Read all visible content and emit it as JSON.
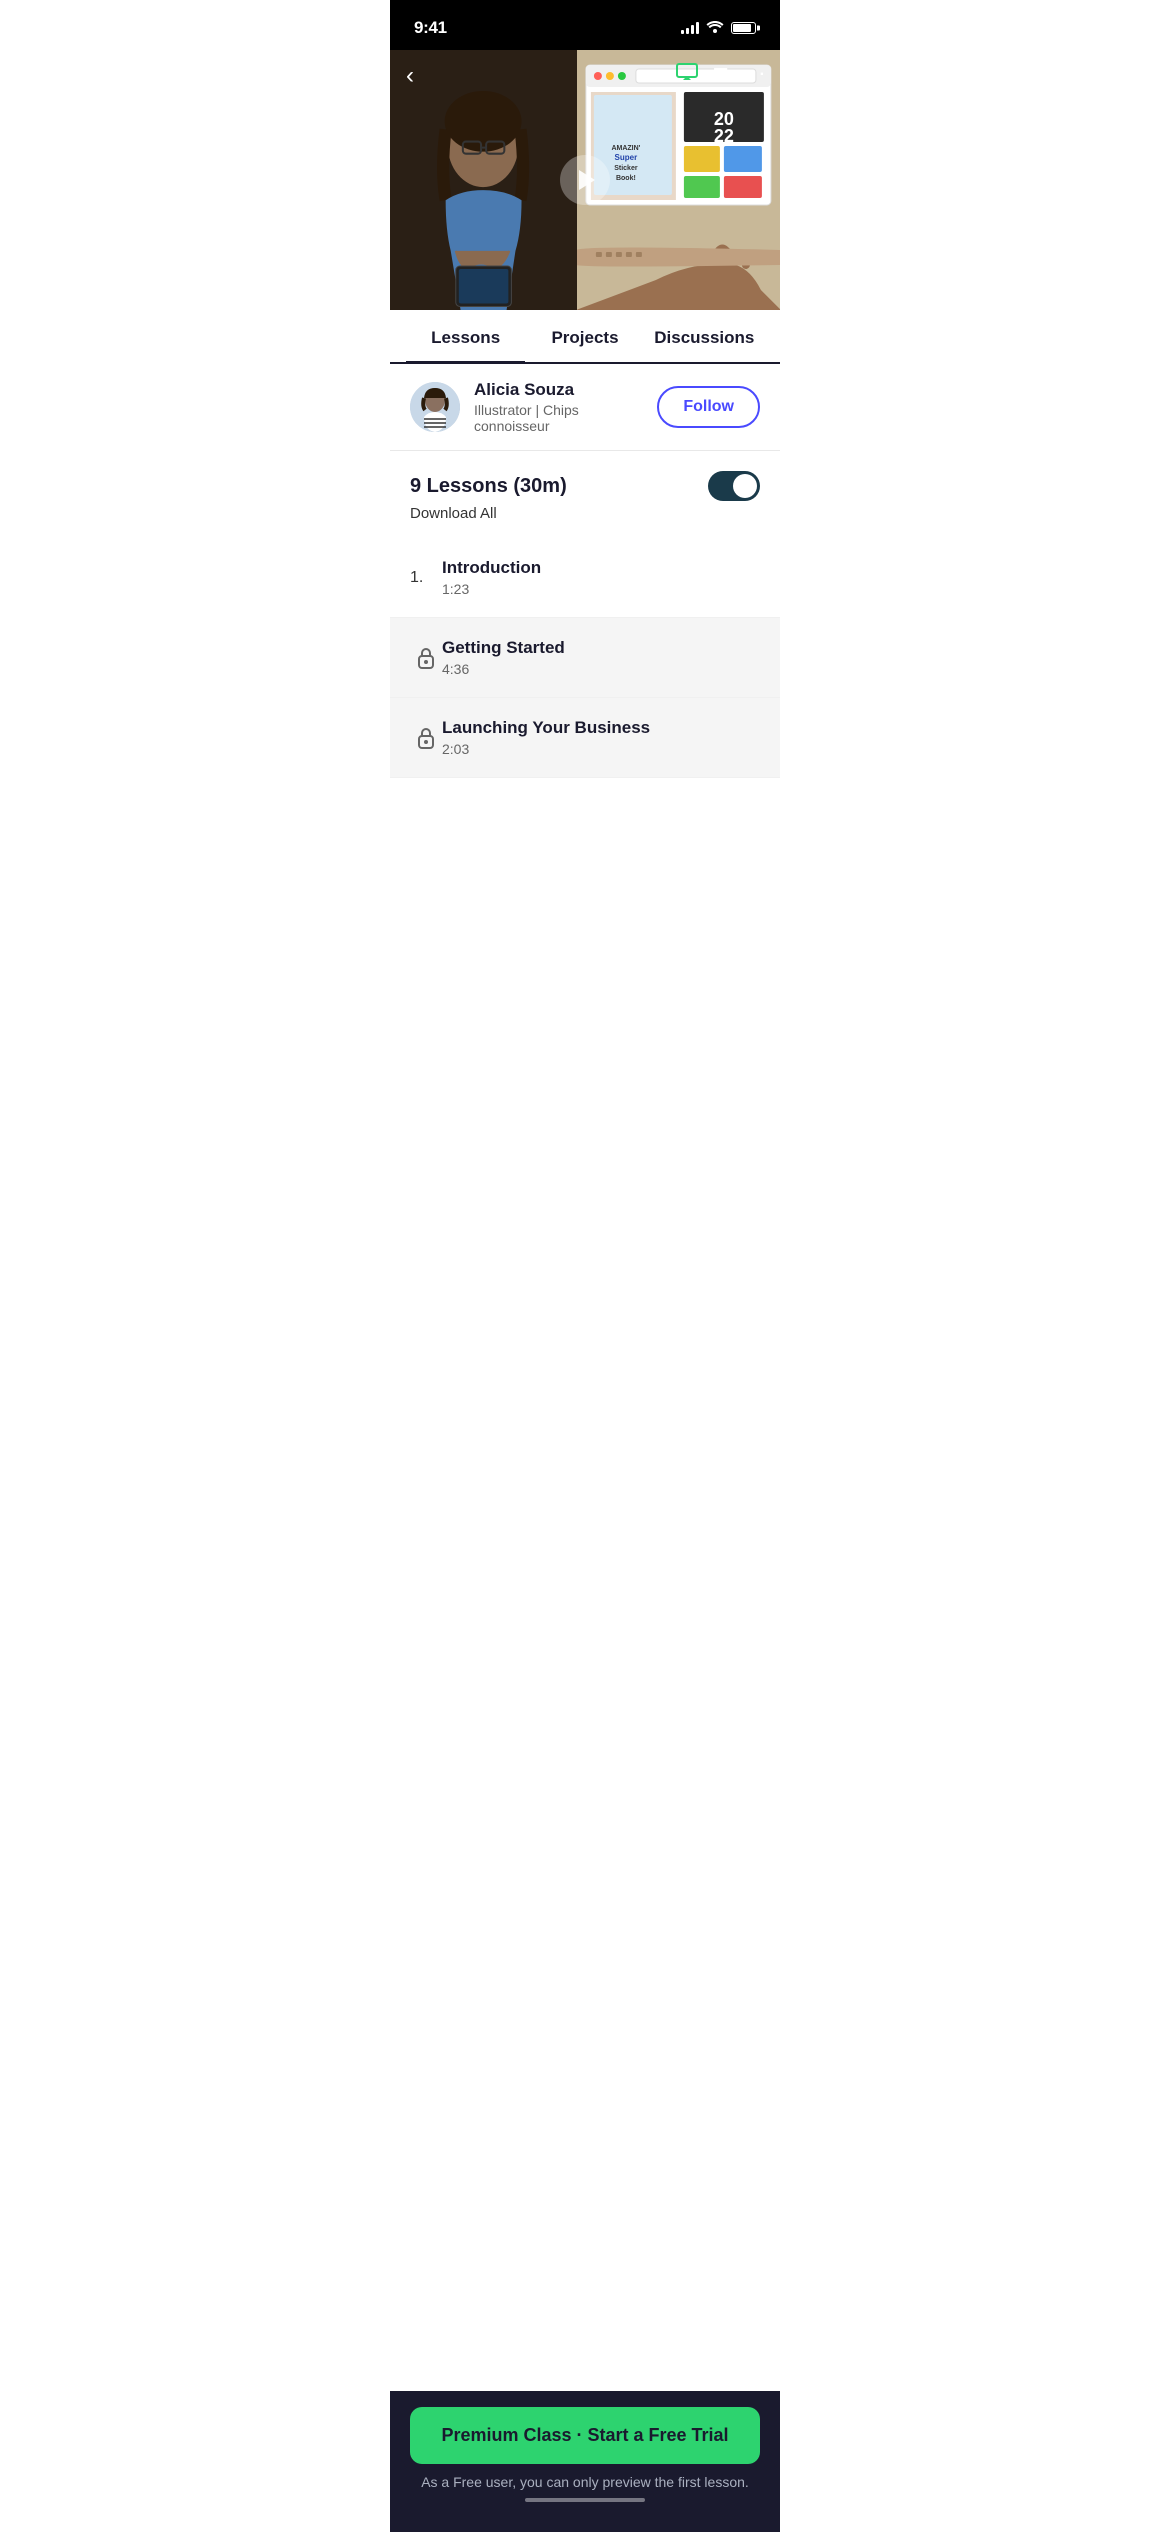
{
  "statusBar": {
    "time": "9:41"
  },
  "header": {
    "back_label": "‹",
    "airplay_icon": "⬛",
    "bookmark_icon": "🔖",
    "more_icon": "···"
  },
  "tabs": [
    {
      "id": "lessons",
      "label": "Lessons",
      "active": true
    },
    {
      "id": "projects",
      "label": "Projects",
      "active": false
    },
    {
      "id": "discussions",
      "label": "Discussions",
      "active": false
    }
  ],
  "author": {
    "name": "Alicia Souza",
    "bio": "Illustrator | Chips connoisseur",
    "follow_label": "Follow"
  },
  "lessonsSection": {
    "title": "9 Lessons (30m)",
    "download_label": "Download All"
  },
  "lessons": [
    {
      "number": "1.",
      "title": "Introduction",
      "duration": "1:23",
      "locked": false
    },
    {
      "title": "Getting Started",
      "duration": "4:36",
      "locked": true
    },
    {
      "title": "Launching Your Business",
      "duration": "2:03",
      "locked": true
    }
  ],
  "cta": {
    "button_label": "Premium Class · Start a Free Trial",
    "subtext": "As a Free user, you can only preview the first lesson."
  }
}
